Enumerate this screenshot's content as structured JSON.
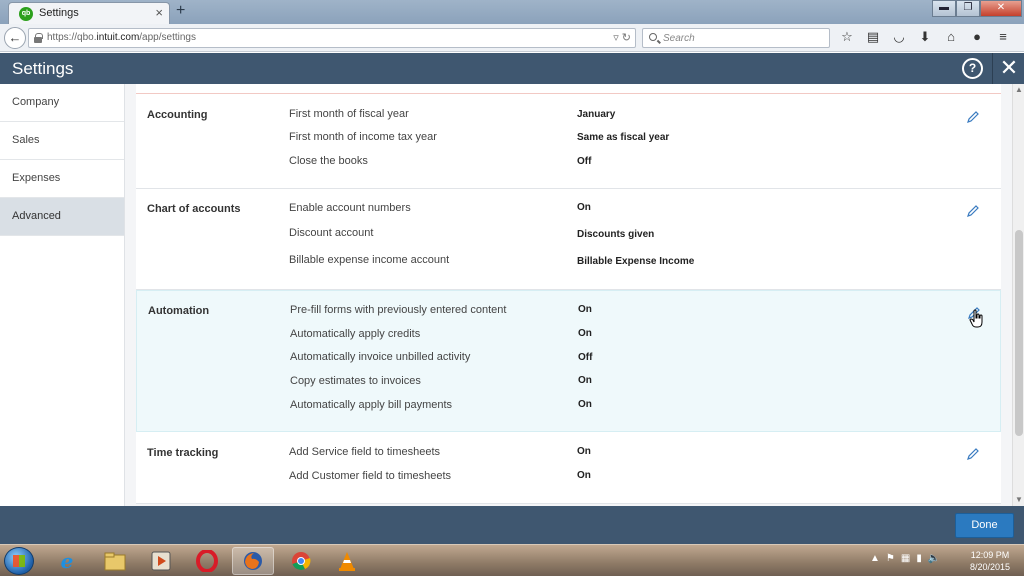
{
  "browser": {
    "tab_title": "Settings",
    "tab_close": "×",
    "new_tab": "+",
    "url_prefix": "https://qbo.",
    "url_domain": "intuit.com",
    "url_path": "/app/settings",
    "search_placeholder": "Search",
    "window_buttons": [
      "▬",
      "❐",
      "✕"
    ]
  },
  "app": {
    "title": "Settings",
    "help_label": "?",
    "close_label": "✕",
    "done_label": "Done"
  },
  "sidebar": {
    "items": [
      {
        "label": "Company"
      },
      {
        "label": "Sales"
      },
      {
        "label": "Expenses"
      },
      {
        "label": "Advanced",
        "active": true
      }
    ]
  },
  "sections": [
    {
      "title": "Accounting",
      "rows": [
        {
          "label": "First month of fiscal year",
          "value": "January"
        },
        {
          "label": "First month of income tax year",
          "value": "Same as fiscal year"
        },
        {
          "label": "Close the books",
          "value": "Off"
        }
      ]
    },
    {
      "title": "Chart of accounts",
      "rows": [
        {
          "label": "Enable account numbers",
          "value": "On"
        },
        {
          "label": "Discount account",
          "value": "Discounts given"
        },
        {
          "label": "Billable expense income account",
          "value": "Billable Expense Income"
        }
      ]
    },
    {
      "title": "Automation",
      "rows": [
        {
          "label": "Pre-fill forms with previously entered content",
          "value": "On"
        },
        {
          "label": "Automatically apply credits",
          "value": "On"
        },
        {
          "label": "Automatically invoice unbilled activity",
          "value": "Off"
        },
        {
          "label": "Copy estimates to invoices",
          "value": "On"
        },
        {
          "label": "Automatically apply bill payments",
          "value": "On"
        }
      ]
    },
    {
      "title": "Time tracking",
      "rows": [
        {
          "label": "Add Service field to timesheets",
          "value": "On"
        },
        {
          "label": "Add Customer field to timesheets",
          "value": "On"
        }
      ]
    }
  ],
  "taskbar": {
    "apps": [
      "internet-explorer-icon",
      "file-explorer-icon",
      "media-player-icon",
      "opera-icon",
      "firefox-icon",
      "chrome-icon",
      "vlc-icon"
    ],
    "time": "12:09 PM",
    "date": "8/20/2015"
  },
  "colors": {
    "header": "#3f5770",
    "done_button": "#2b7ac0",
    "highlight_section": "#eff9fb"
  }
}
